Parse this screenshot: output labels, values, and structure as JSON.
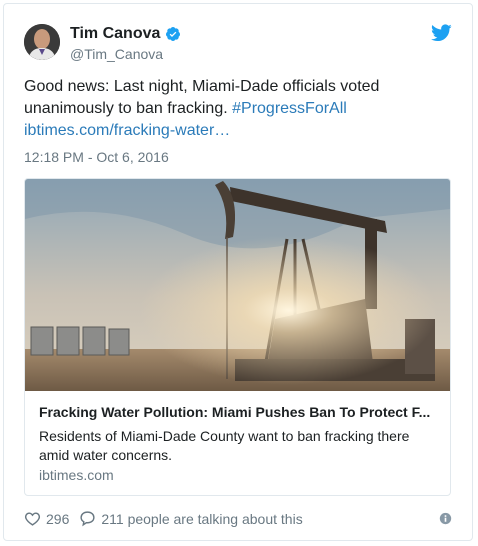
{
  "user": {
    "name": "Tim Canova",
    "handle": "@Tim_Canova"
  },
  "tweet": {
    "text_main": "Good news: Last night, Miami-Dade officials voted unanimously to ban fracking. ",
    "hashtag": "#ProgressForAll",
    "link": "ibtimes.com/fracking-water…",
    "timestamp": "12:18 PM - Oct 6, 2016"
  },
  "card": {
    "title": "Fracking Water Pollution: Miami Pushes Ban To Protect F...",
    "description": "Residents of Miami-Dade County want to ban fracking there amid water concerns.",
    "domain": "ibtimes.com"
  },
  "footer": {
    "likes": "296",
    "talking": "211 people are talking about this"
  },
  "colors": {
    "link": "#2b7bb9",
    "twitter_blue": "#1da1f2",
    "meta": "#697882",
    "border": "#e1e8ed"
  },
  "icons": [
    "verified-badge-icon",
    "twitter-bird-icon",
    "heart-icon",
    "reply-bubble-icon",
    "info-icon"
  ]
}
